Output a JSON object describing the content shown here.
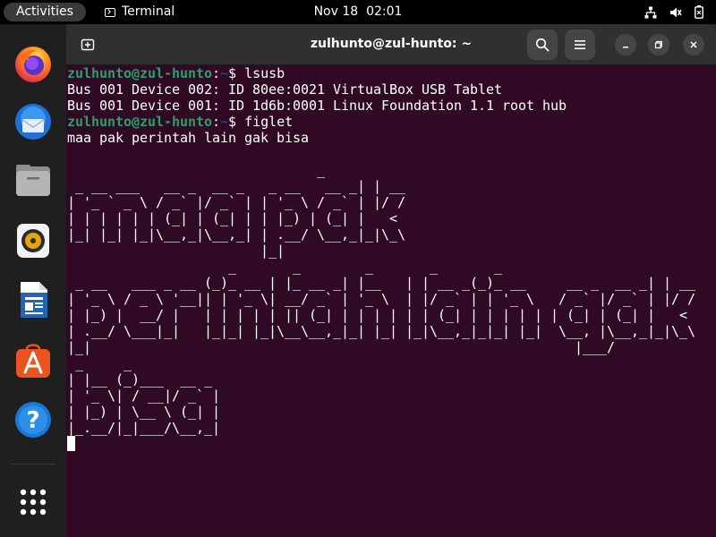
{
  "topbar": {
    "activities_label": "Activities",
    "app_name": "Terminal",
    "date": "Nov 18",
    "time": "02:01",
    "status_icons": [
      "network-icon",
      "volume-icon",
      "battery-icon"
    ]
  },
  "dock": {
    "items": [
      {
        "name": "firefox",
        "icon": "firefox-icon"
      },
      {
        "name": "thunderbird",
        "icon": "thunderbird-icon"
      },
      {
        "name": "files",
        "icon": "files-icon"
      },
      {
        "name": "rhythmbox",
        "icon": "rhythmbox-icon"
      },
      {
        "name": "libreoffice-writer",
        "icon": "writer-icon"
      },
      {
        "name": "app-center",
        "icon": "app-center-icon"
      },
      {
        "name": "help",
        "icon": "help-icon"
      }
    ],
    "show_apps_icon": "grid-icon"
  },
  "window": {
    "title": "zulhunto@zul-hunto: ~",
    "new_tab_icon": "new-tab-icon",
    "search_icon": "search-icon",
    "menu_icon": "hamburger-menu-icon",
    "controls": [
      "minimize-icon",
      "maximize-icon",
      "close-icon"
    ]
  },
  "terminal": {
    "prompt_user": "zulhunto@zul-hunto",
    "prompt_sep": ":",
    "prompt_path": "~",
    "prompt_symbol": "$ ",
    "cmd1": "lsusb",
    "out1": "Bus 001 Device 002: ID 80ee:0021 VirtualBox USB Tablet",
    "out2": "Bus 001 Device 001: ID 1d6b:0001 Linux Foundation 1.1 root hub",
    "cmd2": "figlet",
    "input_text": "maa pak perintah lain gak bisa",
    "figlet_lines": [
      "                               _",
      " _ __ ___   __ _  __ _   _ __   __ _| | __",
      "| '_ ` _ \\ / _` |/ _` | | '_ \\ / _` | |/ /",
      "| | | | | | (_| | (_| | | |_) | (_| |   <",
      "|_| |_| |_|\\__,_|\\__,_| | .__/ \\__,_|_|\\_\\",
      "                        |_|",
      "                    _       _        _       _       _                           _",
      " _ __   ___ _ __ (_)_ __ | |_ __ _| |__   | | __ _(_)_ __     __ _  __ _| | __",
      "| '_ \\ / _ \\ '__|| | '_ \\| __/ _` | '_ \\  | |/ _` | | '_ \\   / _` |/ _` | |/ /",
      "| |_) |  __/ |   | | | | | || (_| | | | | | | (_| | | | | | | (_| | (_| |   <",
      "| .__/ \\___|_|   |_|_| |_|\\__\\__,_|_| |_| |_|\\__,_|_|_| |_|  \\__, |\\__,_|_|\\_\\",
      "|_|                                                            |___/",
      " _     _",
      "| |__ (_)___  __ _",
      "| '_ \\| / __|/ _` |",
      "| |_) | \\__ \\ (_| |",
      "|_.__/|_|___/\\__,_|"
    ]
  },
  "colors": {
    "terminal_bg": "#300a24",
    "prompt_user": "#26a269",
    "prompt_path": "#12488b",
    "headerbar": "#303030",
    "topbar": "#000000",
    "dock": "#1f1f1f"
  }
}
